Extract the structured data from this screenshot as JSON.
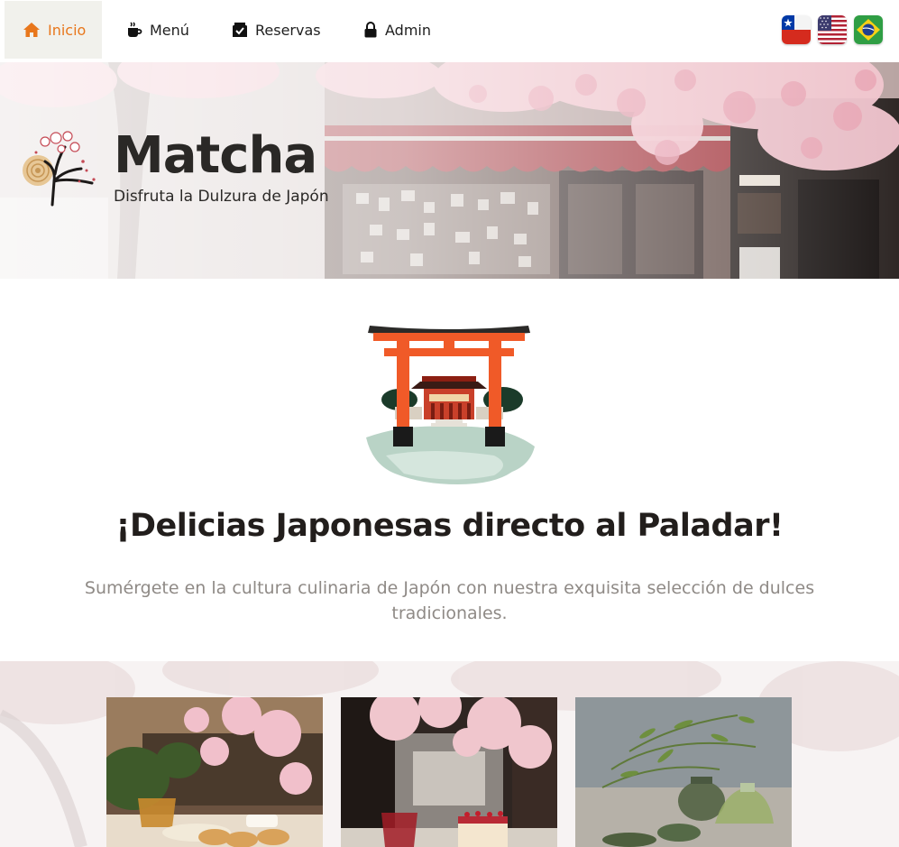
{
  "nav": {
    "items": [
      {
        "label": "Inicio",
        "icon": "home-icon",
        "active": true
      },
      {
        "label": "Menú",
        "icon": "coffee-cup-icon",
        "active": false
      },
      {
        "label": "Reservas",
        "icon": "calendar-check-icon",
        "active": false
      },
      {
        "label": "Admin",
        "icon": "lock-icon",
        "active": false
      }
    ],
    "languages": [
      "chile-flag-icon",
      "usa-flag-icon",
      "brazil-flag-icon"
    ]
  },
  "hero": {
    "title": "Matcha",
    "subtitle": "Disfruta la Dulzura de Japón"
  },
  "intro": {
    "headline": "¡Delicias Japonesas directo al Paladar!",
    "lead": "Sumérgete en la cultura culinaria de Japón con nuestra exquisita selección de dulces tradicionales."
  },
  "colors": {
    "accent": "#e8771c",
    "active_bg": "#f1f1ec",
    "heading": "#221e1c",
    "muted": "#8f8a86"
  }
}
